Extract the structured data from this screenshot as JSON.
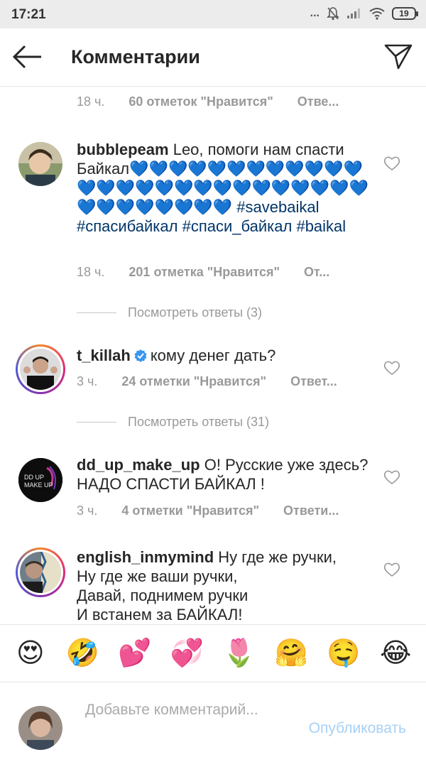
{
  "status_bar": {
    "time": "17:21",
    "signal_dots": "...",
    "battery": "19"
  },
  "header": {
    "title": "Комментарии"
  },
  "top_meta": {
    "time": "18 ч.",
    "likes": "60 отметок \"Нравится\"",
    "reply": "Отве..."
  },
  "comments": [
    {
      "username": "bubblepeam",
      "text_before": "Leo, помоги нам спасти Байкал",
      "emoji_hearts": "💙💙💙💙💙💙💙💙💙💙💙💙💙💙💙💙💙💙💙💙💙💙💙💙💙💙💙💙💙💙💙💙💙💙💙",
      "hashtags": [
        "#savebaikal",
        "#спасибайкал",
        "#спаси_байкал",
        "#baikal"
      ],
      "time": "18 ч.",
      "likes": "201 отметка \"Нравится\"",
      "reply": "От..."
    },
    {
      "username": "t_killah",
      "text": "кому денег дать?",
      "time": "3 ч.",
      "likes": "24 отметки \"Нравится\"",
      "reply": "Ответ..."
    },
    {
      "username": "dd_up_make_up",
      "text": "О! Русские уже здесь?  НАДО СПАСТИ БАЙКАЛ !",
      "time": "3 ч.",
      "likes": "4 отметки \"Нравится\"",
      "reply": "Ответи..."
    },
    {
      "username": "english_inmymind",
      "text_lines": [
        "Ну где же ручки,",
        "Ну где же ваши ручки,",
        "Давай, поднимем ручки",
        "И встанем за БАЙКАЛ!"
      ]
    }
  ],
  "view_replies": {
    "bubblepeam": "Посмотреть ответы (3)",
    "t_killah": "Посмотреть ответы (31)"
  },
  "emoji_bar": [
    "😍",
    "🤣",
    "💕",
    "💞",
    "🌷",
    "🤗",
    "🤤",
    "😂"
  ],
  "composer": {
    "placeholder": "Добавьте комментарий...",
    "publish_label": "Опубликовать"
  },
  "avatar_badge_text": "DD UP\nMAKE UP",
  "colors": {
    "hashtag": "#003569",
    "verified": "#3897f0",
    "publish_disabled": "#a7d1f6",
    "meta_gray": "#999999"
  }
}
